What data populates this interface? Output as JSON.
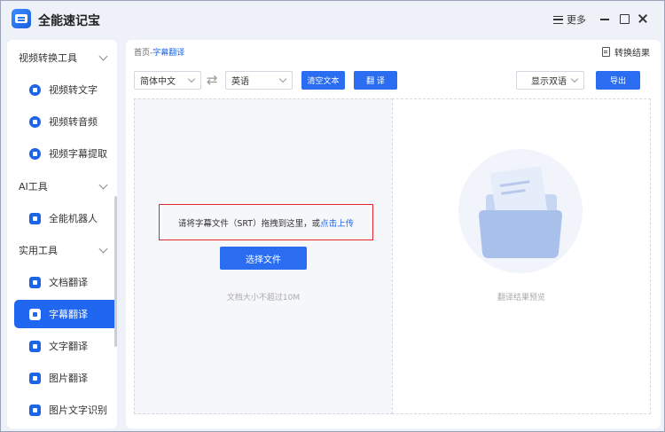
{
  "app": {
    "title": "全能速记宝"
  },
  "titlebar": {
    "more_label": "更多"
  },
  "sidebar": {
    "sections": [
      {
        "label": "视频转换工具"
      },
      {
        "label": "AI工具"
      },
      {
        "label": "实用工具"
      }
    ],
    "items": [
      {
        "label": "视频转文字"
      },
      {
        "label": "视频转音频"
      },
      {
        "label": "视频字幕提取"
      },
      {
        "label": "全能机器人"
      },
      {
        "label": "文档翻译"
      },
      {
        "label": "字幕翻译"
      },
      {
        "label": "文字翻译"
      },
      {
        "label": "图片翻译"
      },
      {
        "label": "图片文字识别"
      }
    ],
    "active_index": 5
  },
  "breadcrumb": {
    "home": "首页",
    "separator": "-",
    "current": "字幕翻译"
  },
  "header": {
    "convert_result_label": "转换结果"
  },
  "toolbar": {
    "source_lang": "简体中文",
    "target_lang": "英语",
    "clear_label": "清空文本",
    "translate_label": "翻 译",
    "display_mode": "显示双语",
    "export_label": "导出"
  },
  "left_pane": {
    "drop_text": "请将字幕文件（SRT）拖拽到这里，或",
    "drop_link": "点击上传",
    "choose_label": "选择文件",
    "size_note": "文档大小不超过10M"
  },
  "right_pane": {
    "preview_note": "翻译结果预览"
  },
  "colors": {
    "accent": "#1f66f0",
    "highlight_box": "#e0262b"
  }
}
